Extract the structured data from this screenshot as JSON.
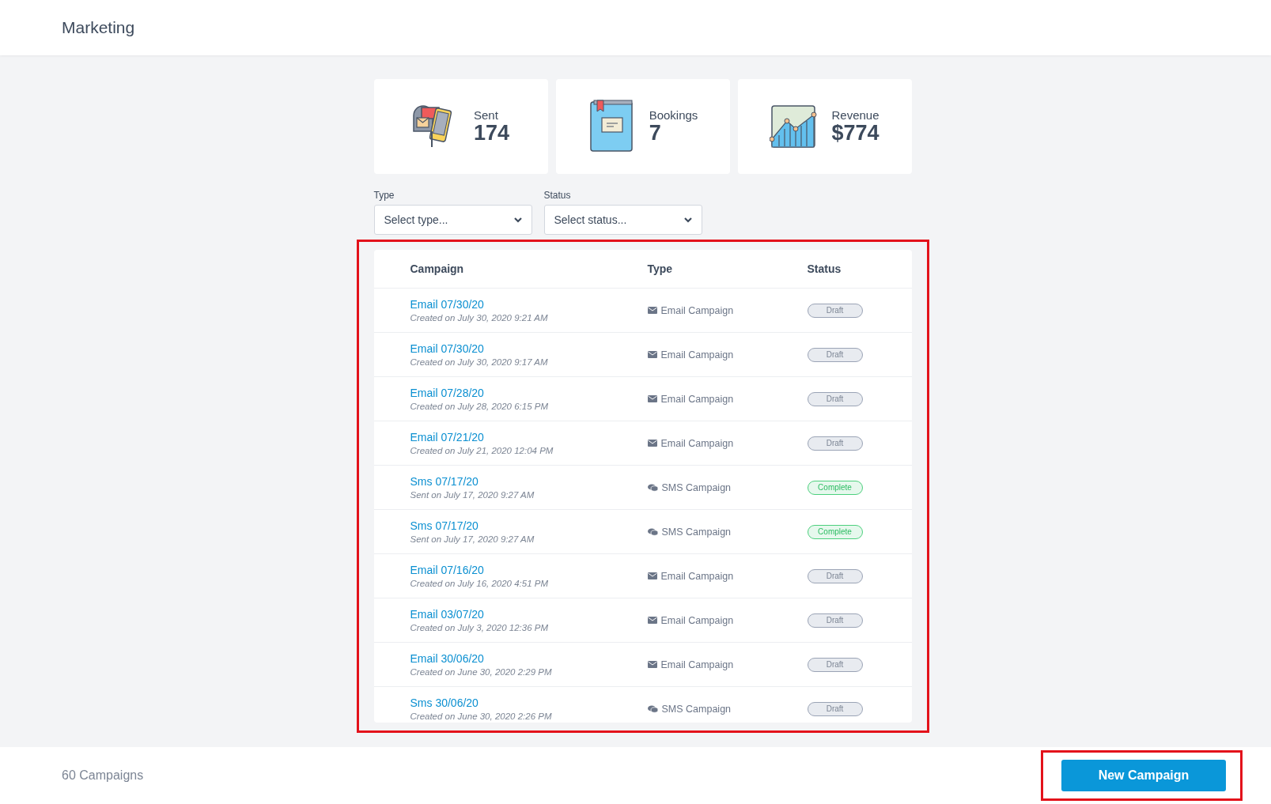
{
  "header": {
    "title": "Marketing"
  },
  "stats": [
    {
      "kind": "sent",
      "label": "Sent",
      "value": "174"
    },
    {
      "kind": "bookings",
      "label": "Bookings",
      "value": "7"
    },
    {
      "kind": "revenue",
      "label": "Revenue",
      "value": "$774"
    }
  ],
  "filters": [
    {
      "label": "Type",
      "placeholder": "Select type..."
    },
    {
      "label": "Status",
      "placeholder": "Select status..."
    }
  ],
  "table": {
    "columns": [
      "Campaign",
      "Type",
      "Status"
    ],
    "rows": [
      {
        "name": "Email 07/30/20",
        "meta": "Created on July 30, 2020 9:21 AM",
        "type": {
          "kind": "email",
          "label": "Email Campaign"
        },
        "status": {
          "kind": "draft",
          "label": "Draft"
        }
      },
      {
        "name": "Email 07/30/20",
        "meta": "Created on July 30, 2020 9:17 AM",
        "type": {
          "kind": "email",
          "label": "Email Campaign"
        },
        "status": {
          "kind": "draft",
          "label": "Draft"
        }
      },
      {
        "name": "Email 07/28/20",
        "meta": "Created on July 28, 2020 6:15 PM",
        "type": {
          "kind": "email",
          "label": "Email Campaign"
        },
        "status": {
          "kind": "draft",
          "label": "Draft"
        }
      },
      {
        "name": "Email 07/21/20",
        "meta": "Created on July 21, 2020 12:04 PM",
        "type": {
          "kind": "email",
          "label": "Email Campaign"
        },
        "status": {
          "kind": "draft",
          "label": "Draft"
        }
      },
      {
        "name": "Sms 07/17/20",
        "meta": "Sent on July 17, 2020 9:27 AM",
        "type": {
          "kind": "sms",
          "label": "SMS Campaign"
        },
        "status": {
          "kind": "complete",
          "label": "Complete"
        }
      },
      {
        "name": "Sms 07/17/20",
        "meta": "Sent on July 17, 2020 9:27 AM",
        "type": {
          "kind": "sms",
          "label": "SMS Campaign"
        },
        "status": {
          "kind": "complete",
          "label": "Complete"
        }
      },
      {
        "name": "Email 07/16/20",
        "meta": "Created on July 16, 2020 4:51 PM",
        "type": {
          "kind": "email",
          "label": "Email Campaign"
        },
        "status": {
          "kind": "draft",
          "label": "Draft"
        }
      },
      {
        "name": "Email 03/07/20",
        "meta": "Created on July 3, 2020 12:36 PM",
        "type": {
          "kind": "email",
          "label": "Email Campaign"
        },
        "status": {
          "kind": "draft",
          "label": "Draft"
        }
      },
      {
        "name": "Email 30/06/20",
        "meta": "Created on June 30, 2020 2:29 PM",
        "type": {
          "kind": "email",
          "label": "Email Campaign"
        },
        "status": {
          "kind": "draft",
          "label": "Draft"
        }
      },
      {
        "name": "Sms 30/06/20",
        "meta": "Created on June 30, 2020 2:26 PM",
        "type": {
          "kind": "sms",
          "label": "SMS Campaign"
        },
        "status": {
          "kind": "draft",
          "label": "Draft"
        }
      }
    ]
  },
  "footer": {
    "count": "60 Campaigns",
    "button": "New Campaign"
  }
}
